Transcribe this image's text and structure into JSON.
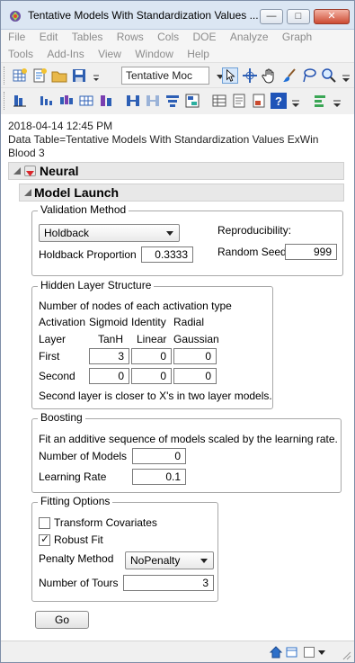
{
  "window": {
    "title": "Tentative Models With Standardization Values ...",
    "controls": [
      "minimize",
      "maximize",
      "close"
    ]
  },
  "menu": {
    "row1": [
      "File",
      "Edit",
      "Tables",
      "Rows",
      "Cols",
      "DOE",
      "Analyze",
      "Graph"
    ],
    "row2": [
      "Tools",
      "Add-Ins",
      "View",
      "Window",
      "Help"
    ]
  },
  "toolbar": {
    "table_combo_value": "Tentative Moc"
  },
  "report": {
    "timestamp": "2018-04-14 12:45 PM",
    "data_table_line1": "Data Table=Tentative Models With Standardization Values ExWin",
    "data_table_line2": "Blood 3",
    "neural_title": "Neural",
    "model_launch_title": "Model Launch"
  },
  "validation": {
    "legend": "Validation Method",
    "method_value": "Holdback",
    "holdback_label": "Holdback Proportion",
    "holdback_value": "0.3333",
    "reproducibility_label": "Reproducibility:",
    "seed_label": "Random Seed",
    "seed_value": "999"
  },
  "hidden_layer": {
    "legend": "Hidden Layer Structure",
    "intro": "Number of nodes of each activation type",
    "activation_label": "Activation",
    "layer_label": "Layer",
    "types": [
      "Sigmoid",
      "Identity",
      "Radial"
    ],
    "functions": [
      "TanH",
      "Linear",
      "Gaussian"
    ],
    "rows": [
      {
        "label": "First",
        "values": [
          "3",
          "0",
          "0"
        ]
      },
      {
        "label": "Second",
        "values": [
          "0",
          "0",
          "0"
        ]
      }
    ],
    "note": "Second layer is closer to X's in two layer models."
  },
  "boosting": {
    "legend": "Boosting",
    "intro": "Fit an additive sequence of models scaled by the learning rate.",
    "models_label": "Number of Models",
    "models_value": "0",
    "rate_label": "Learning Rate",
    "rate_value": "0.1"
  },
  "fitting": {
    "legend": "Fitting Options",
    "transform_label": "Transform Covariates",
    "transform_checked": false,
    "robust_label": "Robust Fit",
    "robust_checked": true,
    "penalty_label": "Penalty Method",
    "penalty_value": "NoPenalty",
    "tours_label": "Number of Tours",
    "tours_value": "3"
  },
  "go_label": "Go",
  "colors": {
    "title_bar": "#dbe6f3",
    "outline_header": "#e8e8e8",
    "red_triangle": "#d9262b",
    "close_button": "#cc4b33"
  }
}
